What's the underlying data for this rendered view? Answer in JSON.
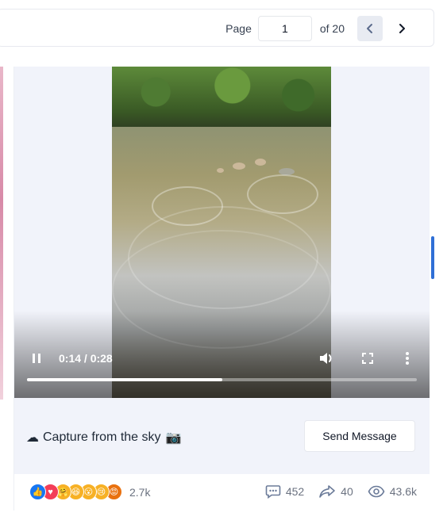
{
  "pagination": {
    "page_label": "Page",
    "current_page": "1",
    "of_label": "of 20",
    "prev_icon": "chevron-left-icon",
    "next_icon": "chevron-right-icon"
  },
  "video": {
    "time": "0:14 / 0:28",
    "progress": 0.5,
    "icons": [
      "pause-icon",
      "volume-icon",
      "fullscreen-icon",
      "more-vertical-icon"
    ]
  },
  "post": {
    "caption": "Capture from the sky",
    "caption_emoji_start": "☁",
    "caption_emoji_end": "📷",
    "send_button": "Send Message"
  },
  "reactions": {
    "emojis": [
      {
        "name": "like",
        "glyph": "👍",
        "color": "#1877f2"
      },
      {
        "name": "love",
        "glyph": "♥",
        "color": "#f33e58"
      },
      {
        "name": "care",
        "glyph": "🤗",
        "color": "#f7b125"
      },
      {
        "name": "haha",
        "glyph": "😆",
        "color": "#f7b125"
      },
      {
        "name": "wow",
        "glyph": "😮",
        "color": "#f7b125"
      },
      {
        "name": "sad",
        "glyph": "😢",
        "color": "#f7b125"
      },
      {
        "name": "angry",
        "glyph": "😡",
        "color": "#e9710f"
      }
    ],
    "count": "2.7k"
  },
  "stats": {
    "comments": "452",
    "shares": "40",
    "views": "43.6k"
  },
  "colors": {
    "accent": "#2f6fd6",
    "muted_text": "#6b7280",
    "panel_bg": "#f1f3fa"
  }
}
